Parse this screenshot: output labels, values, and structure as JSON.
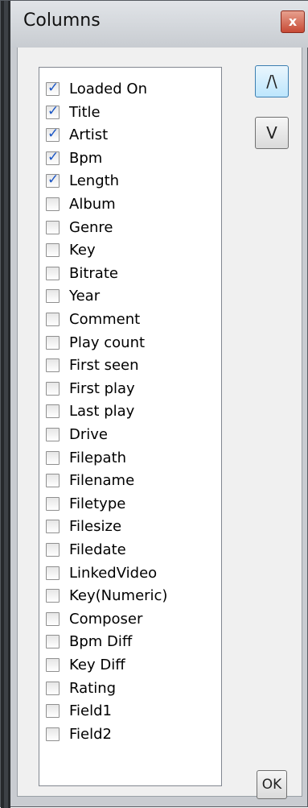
{
  "window": {
    "title": "Columns",
    "close_symbol": "x"
  },
  "buttons": {
    "move_up_label": "/\\",
    "move_down_label": "V",
    "ok_label": "OK"
  },
  "columns": [
    {
      "label": "Loaded On",
      "checked": true
    },
    {
      "label": "Title",
      "checked": true
    },
    {
      "label": "Artist",
      "checked": true
    },
    {
      "label": "Bpm",
      "checked": true
    },
    {
      "label": "Length",
      "checked": true
    },
    {
      "label": "Album",
      "checked": false
    },
    {
      "label": "Genre",
      "checked": false
    },
    {
      "label": "Key",
      "checked": false
    },
    {
      "label": "Bitrate",
      "checked": false
    },
    {
      "label": "Year",
      "checked": false
    },
    {
      "label": "Comment",
      "checked": false
    },
    {
      "label": "Play count",
      "checked": false
    },
    {
      "label": "First seen",
      "checked": false
    },
    {
      "label": "First play",
      "checked": false
    },
    {
      "label": "Last play",
      "checked": false
    },
    {
      "label": "Drive",
      "checked": false
    },
    {
      "label": "Filepath",
      "checked": false
    },
    {
      "label": "Filename",
      "checked": false
    },
    {
      "label": "Filetype",
      "checked": false
    },
    {
      "label": "Filesize",
      "checked": false
    },
    {
      "label": "Filedate",
      "checked": false
    },
    {
      "label": "LinkedVideo",
      "checked": false
    },
    {
      "label": "Key(Numeric)",
      "checked": false
    },
    {
      "label": "Composer",
      "checked": false
    },
    {
      "label": "Bpm Diff",
      "checked": false
    },
    {
      "label": "Key Diff",
      "checked": false
    },
    {
      "label": "Rating",
      "checked": false
    },
    {
      "label": "Field1",
      "checked": false
    },
    {
      "label": "Field2",
      "checked": false
    }
  ]
}
